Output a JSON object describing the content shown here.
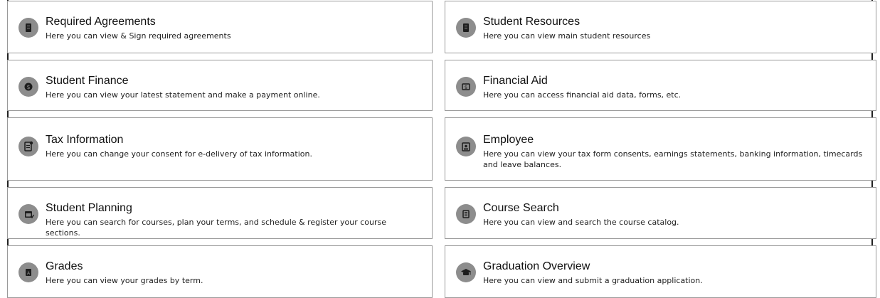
{
  "cards": {
    "required_agreements": {
      "title": "Required Agreements",
      "desc": "Here you can view & Sign required agreements",
      "icon": "document-icon"
    },
    "student_resources": {
      "title": "Student Resources",
      "desc": "Here you can view main student resources",
      "icon": "document-icon"
    },
    "student_finance": {
      "title": "Student Finance",
      "desc": "Here you can view your latest statement and make a payment online.",
      "icon": "dollar-coin-icon"
    },
    "financial_aid": {
      "title": "Financial Aid",
      "desc": "Here you can access financial aid data, forms, etc.",
      "icon": "money-bill-icon"
    },
    "tax_information": {
      "title": "Tax Information",
      "desc": "Here you can change your consent for e-delivery of tax information.",
      "icon": "tax-form-icon"
    },
    "employee": {
      "title": "Employee",
      "desc": "Here you can view your tax form consents, earnings statements, banking information, timecards and leave balances.",
      "icon": "id-badge-icon"
    },
    "student_planning": {
      "title": "Student Planning",
      "desc": "Here you can search for courses, plan your terms, and schedule & register your course sections.",
      "icon": "calendar-check-icon"
    },
    "course_search": {
      "title": "Course Search",
      "desc": "Here you can view and search the course catalog.",
      "icon": "catalog-book-icon"
    },
    "grades": {
      "title": "Grades",
      "desc": "Here you can view your grades by term.",
      "icon": "grade-report-icon"
    },
    "graduation_overview": {
      "title": "Graduation Overview",
      "desc": "Here you can view and submit a graduation application.",
      "icon": "graduation-cap-icon"
    }
  }
}
